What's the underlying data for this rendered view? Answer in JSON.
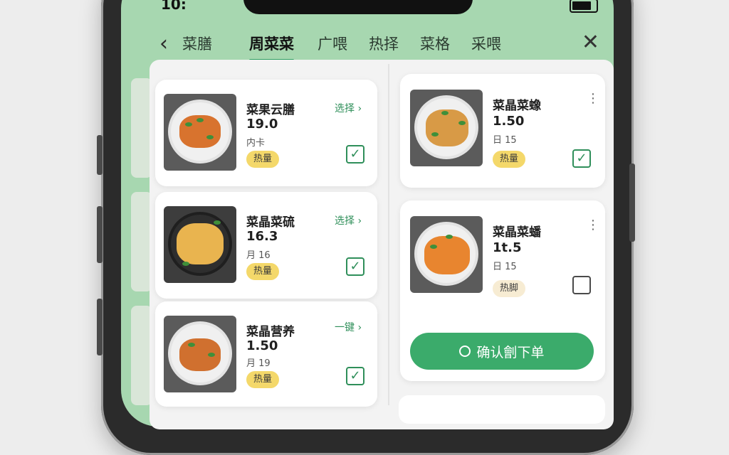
{
  "status_bar": {
    "time": "10:"
  },
  "nav": {
    "back_label": "菜膳",
    "tabs": [
      {
        "label": "周菜菜",
        "active": true
      },
      {
        "label": "广喂"
      },
      {
        "label": "热择"
      },
      {
        "label": "菜格"
      },
      {
        "label": "采喂"
      }
    ]
  },
  "left_items": [
    {
      "name": "菜果云膳",
      "price": "19.0",
      "meta": "内卡",
      "badge": "热量",
      "action": "选择",
      "checked": true
    },
    {
      "name": "菜晶菜硫",
      "price": "16.3",
      "meta": "月 16",
      "badge": "热量",
      "action": "选择",
      "checked": true
    },
    {
      "name": "菜晶营养",
      "price": "1.50",
      "meta": "月 19",
      "badge": "热量",
      "action": "一键",
      "checked": true
    }
  ],
  "right_items": [
    {
      "name": "菜晶菜蟓",
      "price": "1.50",
      "meta": "日 15",
      "badge": "热量",
      "checked": true
    },
    {
      "name": "菜晶菜蟠",
      "price": "1t.5",
      "meta": "日 15",
      "badge": "热脚",
      "checked": false
    }
  ],
  "confirm_button": {
    "label": "确认劊下单"
  },
  "colors": {
    "accent": "#3bab6b",
    "nav_bg": "#a7d7b0",
    "badge": "#f4d86a"
  },
  "icons": [
    "back-icon",
    "close-icon",
    "chevron-right-icon",
    "more-icon",
    "checkmark-icon",
    "circle-icon"
  ]
}
